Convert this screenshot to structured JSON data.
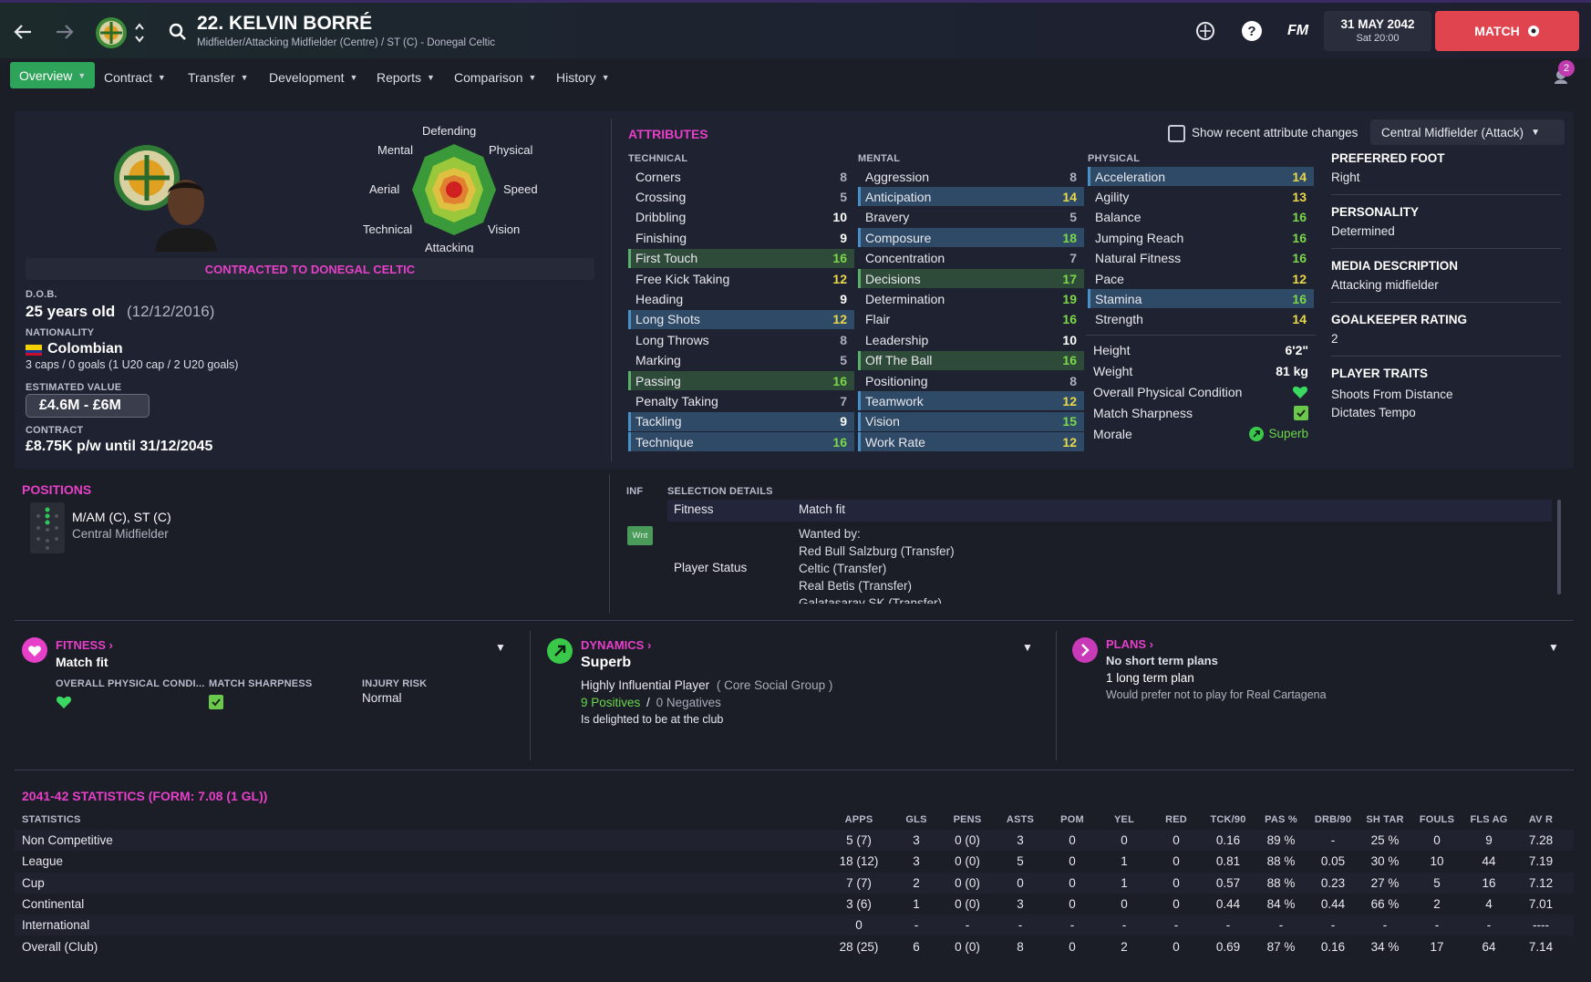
{
  "header": {
    "player_name": "22. KELVIN BORRÉ",
    "player_sub": "Midfielder/Attacking Midfielder (Centre) / ST (C) - Donegal Celtic",
    "date": "31 MAY 2042",
    "time": "Sat 20:00",
    "match_label": "MATCH",
    "fm_label": "FM",
    "notif_count": "2"
  },
  "nav": {
    "tabs": [
      "Overview",
      "Contract",
      "Transfer",
      "Development",
      "Reports",
      "Comparison",
      "History"
    ]
  },
  "profile": {
    "contract_banner": "CONTRACTED TO DONEGAL CELTIC",
    "dob_label": "D.O.B.",
    "age": "25 years old",
    "dob": "(12/12/2016)",
    "nationality_label": "NATIONALITY",
    "nationality": "Colombian",
    "caps": "3 caps / 0 goals (1 U20 cap / 2 U20 goals)",
    "value_label": "ESTIMATED VALUE",
    "value": "£4.6M - £6M",
    "contract_label": "CONTRACT",
    "contract": "£8.75K p/w until 31/12/2045",
    "radar": {
      "labels": [
        "Defending",
        "Physical",
        "Speed",
        "Vision",
        "Attacking",
        "Technical",
        "Aerial",
        "Mental"
      ]
    }
  },
  "attributes": {
    "title": "ATTRIBUTES",
    "show_recent": "Show recent attribute changes",
    "role": "Central Midfielder (Attack)",
    "technical_label": "TECHNICAL",
    "mental_label": "MENTAL",
    "physical_label": "PHYSICAL",
    "technical": [
      {
        "name": "Corners",
        "value": "8"
      },
      {
        "name": "Crossing",
        "value": "5"
      },
      {
        "name": "Dribbling",
        "value": "10"
      },
      {
        "name": "Finishing",
        "value": "9"
      },
      {
        "name": "First Touch",
        "value": "16"
      },
      {
        "name": "Free Kick Taking",
        "value": "12"
      },
      {
        "name": "Heading",
        "value": "9"
      },
      {
        "name": "Long Shots",
        "value": "12"
      },
      {
        "name": "Long Throws",
        "value": "8"
      },
      {
        "name": "Marking",
        "value": "5"
      },
      {
        "name": "Passing",
        "value": "16"
      },
      {
        "name": "Penalty Taking",
        "value": "7"
      },
      {
        "name": "Tackling",
        "value": "9"
      },
      {
        "name": "Technique",
        "value": "16"
      }
    ],
    "mental": [
      {
        "name": "Aggression",
        "value": "8"
      },
      {
        "name": "Anticipation",
        "value": "14"
      },
      {
        "name": "Bravery",
        "value": "5"
      },
      {
        "name": "Composure",
        "value": "18"
      },
      {
        "name": "Concentration",
        "value": "7"
      },
      {
        "name": "Decisions",
        "value": "17"
      },
      {
        "name": "Determination",
        "value": "19"
      },
      {
        "name": "Flair",
        "value": "16"
      },
      {
        "name": "Leadership",
        "value": "10"
      },
      {
        "name": "Off The Ball",
        "value": "16"
      },
      {
        "name": "Positioning",
        "value": "8"
      },
      {
        "name": "Teamwork",
        "value": "12"
      },
      {
        "name": "Vision",
        "value": "15"
      },
      {
        "name": "Work Rate",
        "value": "12"
      }
    ],
    "physical": [
      {
        "name": "Acceleration",
        "value": "14"
      },
      {
        "name": "Agility",
        "value": "13"
      },
      {
        "name": "Balance",
        "value": "16"
      },
      {
        "name": "Jumping Reach",
        "value": "16"
      },
      {
        "name": "Natural Fitness",
        "value": "16"
      },
      {
        "name": "Pace",
        "value": "12"
      },
      {
        "name": "Stamina",
        "value": "16"
      },
      {
        "name": "Strength",
        "value": "14"
      }
    ],
    "height_label": "Height",
    "height": "6'2\"",
    "weight_label": "Weight",
    "weight": "81 kg",
    "opc_label": "Overall Physical Condition",
    "sharp_label": "Match Sharpness",
    "morale_label": "Morale",
    "morale": "Superb"
  },
  "side_info": {
    "foot_label": "PREFERRED FOOT",
    "foot": "Right",
    "personality_label": "PERSONALITY",
    "personality": "Determined",
    "media_label": "MEDIA DESCRIPTION",
    "media": "Attacking midfielder",
    "gk_label": "GOALKEEPER RATING",
    "gk": "2",
    "traits_label": "PLAYER TRAITS",
    "traits": [
      "Shoots From Distance",
      "Dictates Tempo"
    ]
  },
  "positions": {
    "title": "POSITIONS",
    "primary": "M/AM (C), ST (C)",
    "secondary": "Central Midfielder"
  },
  "selection": {
    "inf_label": "INF",
    "details_label": "SELECTION DETAILS",
    "fitness_label": "Fitness",
    "fitness": "Match fit",
    "badge": "Wnt",
    "status_label": "Player Status",
    "wanted_by": "Wanted by:",
    "clubs": [
      "Red Bull Salzburg (Transfer)",
      "Celtic (Transfer)",
      "Real Betis (Transfer)",
      "Galatasaray SK (Transfer)"
    ]
  },
  "fitness_card": {
    "title": "FITNESS",
    "status": "Match fit",
    "opc_label": "OVERALL PHYSICAL CONDI...",
    "sharp_label": "MATCH SHARPNESS",
    "injury_label": "INJURY RISK",
    "injury": "Normal"
  },
  "dynamics_card": {
    "title": "DYNAMICS",
    "status": "Superb",
    "influence": "Highly Influential Player",
    "group": "( Core Social Group )",
    "positives": "9 Positives",
    "sep": "/",
    "negatives": "0 Negatives",
    "note": "Is delighted to be at the club"
  },
  "plans_card": {
    "title": "PLANS",
    "short": "No short term plans",
    "long": "1 long term plan",
    "note": "Would prefer not to play for Real Cartagena"
  },
  "stats": {
    "title": "2041-42 STATISTICS (FORM: 7.08 (1 GL))",
    "header_label": "STATISTICS",
    "columns": [
      "APPS",
      "GLS",
      "PENS",
      "ASTS",
      "POM",
      "YEL",
      "RED",
      "TCK/90",
      "PAS %",
      "DRB/90",
      "SH TAR",
      "FOULS",
      "FLS AG",
      "AV R"
    ],
    "rows": [
      {
        "name": "Non Competitive",
        "cells": [
          "5 (7)",
          "3",
          "0 (0)",
          "3",
          "0",
          "0",
          "0",
          "0.16",
          "89 %",
          "-",
          "25 %",
          "0",
          "9",
          "7.28"
        ]
      },
      {
        "name": "League",
        "cells": [
          "18 (12)",
          "3",
          "0 (0)",
          "5",
          "0",
          "1",
          "0",
          "0.81",
          "88 %",
          "0.05",
          "30 %",
          "10",
          "44",
          "7.19"
        ]
      },
      {
        "name": "Cup",
        "cells": [
          "7 (7)",
          "2",
          "0 (0)",
          "0",
          "0",
          "1",
          "0",
          "0.57",
          "88 %",
          "0.23",
          "27 %",
          "5",
          "16",
          "7.12"
        ]
      },
      {
        "name": "Continental",
        "cells": [
          "3 (6)",
          "1",
          "0 (0)",
          "3",
          "0",
          "0",
          "0",
          "0.44",
          "84 %",
          "0.44",
          "66 %",
          "2",
          "4",
          "7.01"
        ]
      },
      {
        "name": "International",
        "cells": [
          "0",
          "-",
          "-",
          "-",
          "-",
          "-",
          "-",
          "-",
          "-",
          "-",
          "-",
          "-",
          "-",
          "----"
        ]
      },
      {
        "name": "Overall (Club)",
        "cells": [
          "28 (25)",
          "6",
          "0 (0)",
          "8",
          "0",
          "2",
          "0",
          "0.69",
          "87 %",
          "0.16",
          "34 %",
          "17",
          "64",
          "7.14"
        ]
      }
    ]
  },
  "colors": {
    "accent": "#e640c8",
    "green": "#2ea35a",
    "match": "#e0454f"
  }
}
